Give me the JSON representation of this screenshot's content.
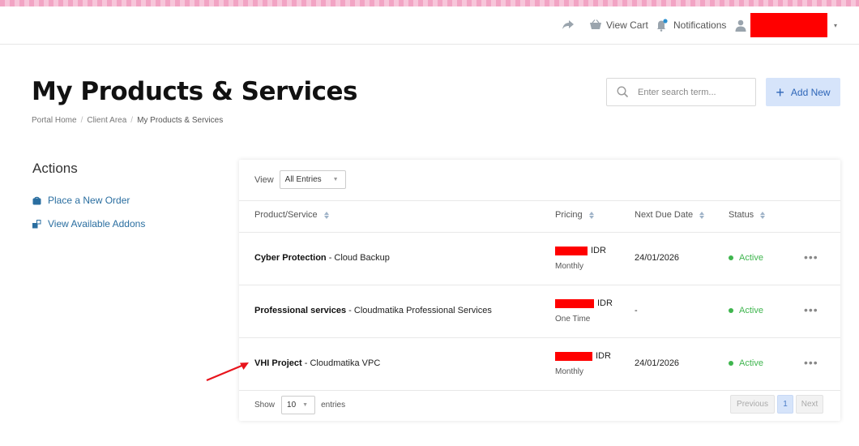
{
  "header": {
    "view_cart": "View Cart",
    "notifications": "Notifications",
    "user_caret": "▾"
  },
  "page": {
    "title": "My Products & Services",
    "breadcrumb": [
      "Portal Home",
      "Client Area",
      "My Products & Services"
    ],
    "breadcrumb_sep": "/",
    "search_placeholder": "Enter search term...",
    "add_new": "Add New",
    "add_new_plus": "+"
  },
  "sidebar": {
    "title": "Actions",
    "links": [
      "Place a New Order",
      "View Available Addons"
    ]
  },
  "table": {
    "view_label": "View",
    "view_value": "All Entries",
    "columns": [
      "Product/Service",
      "Pricing",
      "Next Due Date",
      "Status"
    ],
    "rows": [
      {
        "product": "Cyber Protection",
        "detail": " - Cloud Backup",
        "currency": "IDR",
        "cycle": "Monthly",
        "due": "24/01/2026",
        "status": "Active"
      },
      {
        "product": "Professional services",
        "detail": " - Cloudmatika Professional Services",
        "currency": "IDR",
        "cycle": "One Time",
        "due": "-",
        "status": "Active"
      },
      {
        "product": "VHI Project",
        "detail": " - Cloudmatika VPC",
        "currency": "IDR",
        "cycle": "Monthly",
        "due": "24/01/2026",
        "status": "Active"
      }
    ],
    "more_glyph": "•••",
    "show_label": "Show",
    "show_value": "10",
    "entries_label": "entries",
    "pagination": {
      "prev": "Previous",
      "page": "1",
      "next": "Next"
    }
  },
  "colors": {
    "accent": "#2a6ea0",
    "status_active": "#3fb54e",
    "add_new_bg": "#d6e4fa",
    "redaction": "#ff0000",
    "annotation_arrow": "#e8141c"
  }
}
